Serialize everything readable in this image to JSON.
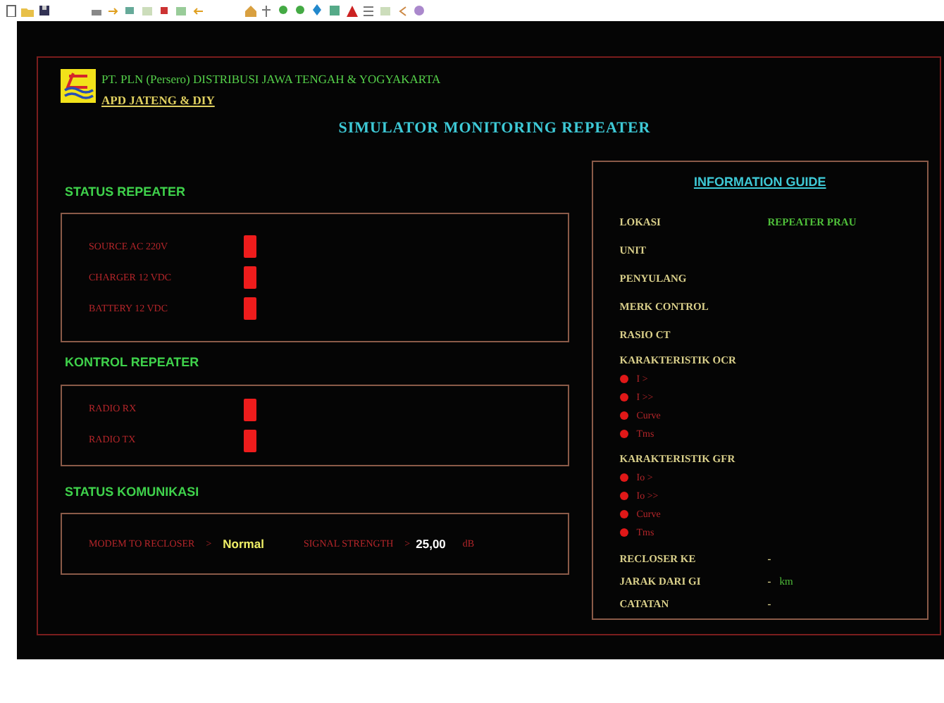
{
  "header": {
    "company": "PT. PLN (Persero) DISTRIBUSI JAWA TENGAH & YOGYAKARTA",
    "unit": "APD JATENG & DIY"
  },
  "title": "SIMULATOR MONITORING REPEATER",
  "status_repeater": {
    "heading": "STATUS REPEATER",
    "items": [
      {
        "label": "SOURCE AC 220V",
        "on": false
      },
      {
        "label": "CHARGER 12 VDC",
        "on": false
      },
      {
        "label": "BATTERY 12 VDC",
        "on": false
      }
    ]
  },
  "kontrol_repeater": {
    "heading": "KONTROL REPEATER",
    "items": [
      {
        "label": "RADIO RX",
        "on": false
      },
      {
        "label": "RADIO TX",
        "on": false
      }
    ]
  },
  "status_komunikasi": {
    "heading": "STATUS KOMUNIKASI",
    "modem_label": "MODEM TO RECLOSER",
    "modem_arrow": ">",
    "modem_value": "Normal",
    "signal_label": "SIGNAL STRENGTH",
    "signal_arrow": ">",
    "signal_value": "25,00",
    "signal_unit": "dB"
  },
  "information_guide": {
    "heading": "INFORMATION GUIDE",
    "fields": [
      {
        "kind": "field",
        "label": "LOKASI",
        "value": "REPEATER PRAU"
      },
      {
        "kind": "field",
        "label": "UNIT"
      },
      {
        "kind": "field",
        "label": "PENYULANG"
      },
      {
        "kind": "field",
        "label": "MERK CONTROL"
      },
      {
        "kind": "field",
        "label": "RASIO CT"
      },
      {
        "kind": "group",
        "label": "KARAKTERISTIK OCR",
        "items": [
          {
            "label": "I >",
            "on": false
          },
          {
            "label": "I >>",
            "on": false
          },
          {
            "label": "Curve",
            "on": false
          },
          {
            "label": "Tms",
            "on": false
          }
        ]
      },
      {
        "kind": "group",
        "label": "KARAKTERISTIK GFR",
        "items": [
          {
            "label": "Io >",
            "on": false
          },
          {
            "label": "Io >>",
            "on": false
          },
          {
            "label": "Curve",
            "on": false
          },
          {
            "label": "Tms",
            "on": false
          }
        ]
      },
      {
        "kind": "field",
        "label": "RECLOSER KE",
        "value": "-"
      },
      {
        "kind": "field",
        "label": "JARAK DARI GI",
        "value": "-",
        "unit": "km"
      },
      {
        "kind": "field",
        "label": "CATATAN",
        "value": "-"
      }
    ]
  }
}
